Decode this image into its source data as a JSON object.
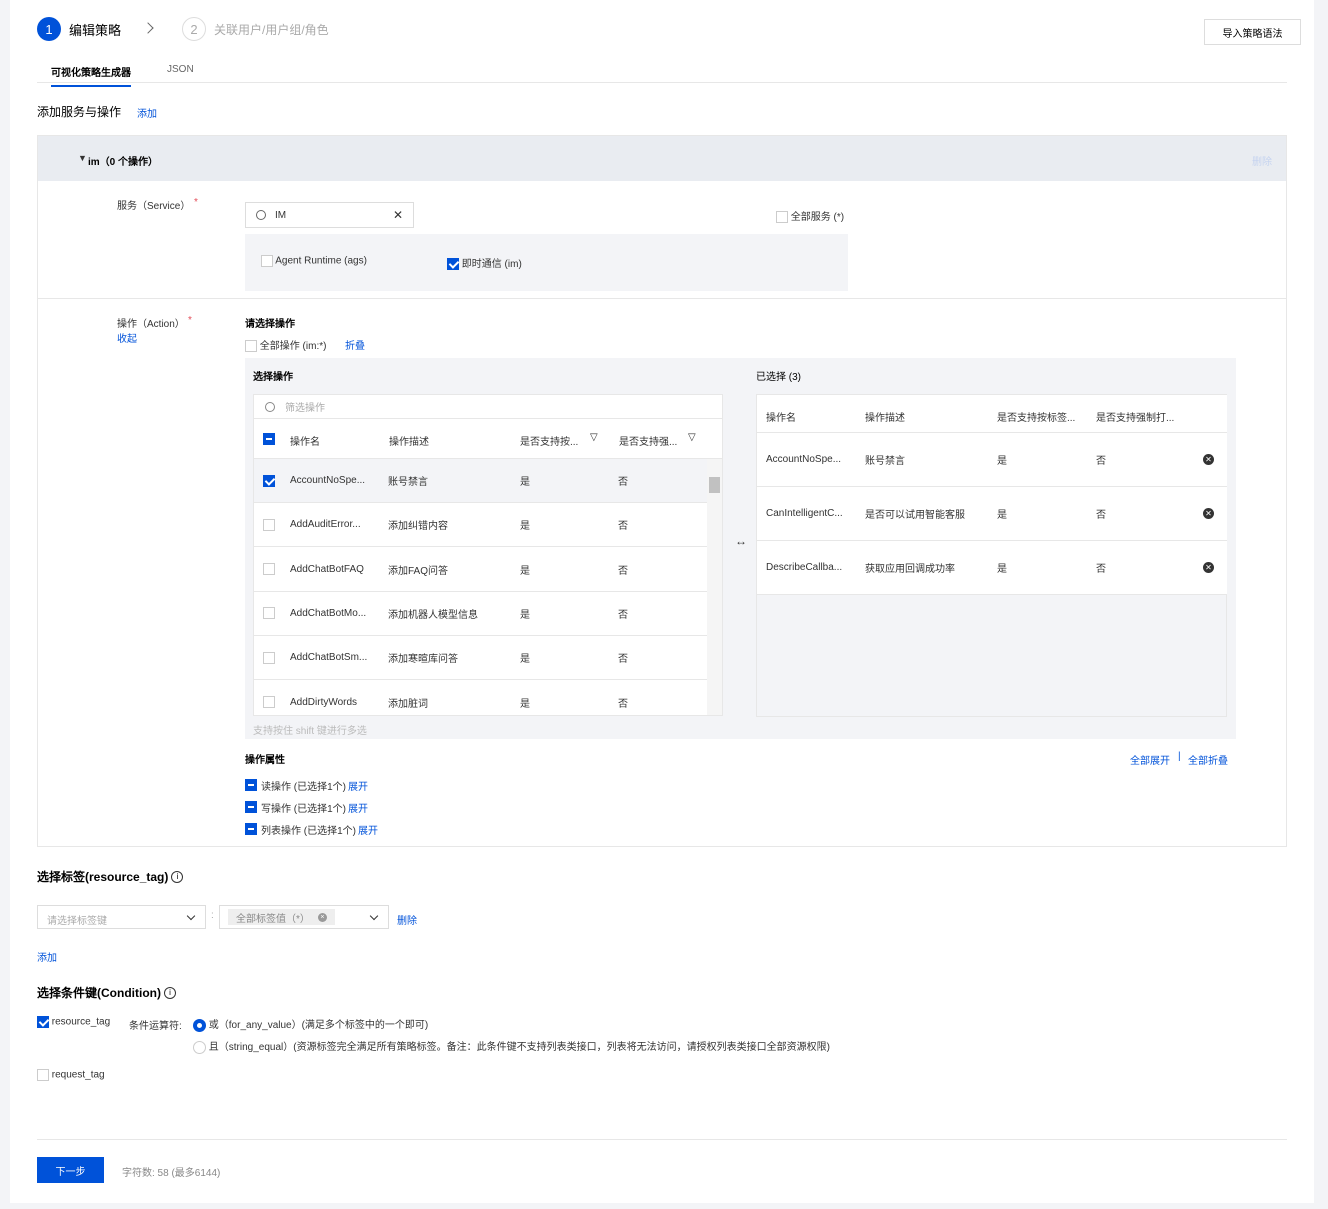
{
  "steps": [
    {
      "num": "1",
      "label": "编辑策略"
    },
    {
      "num": "2",
      "label": "关联用户/用户组/角色"
    }
  ],
  "import_button": "导入策略语法",
  "tabs": [
    {
      "label": "可视化策略生成器",
      "active": true
    },
    {
      "label": "JSON",
      "active": false
    }
  ],
  "section_title": "添加服务与操作",
  "section_add": "添加",
  "service_block": {
    "title": "im（0 个操作）",
    "delete": "删除",
    "service_label": "服务（Service）",
    "required": "*",
    "search_value": "IM",
    "all_services": "全部服务 (*)",
    "options": [
      {
        "label": "Agent Runtime (ags)",
        "checked": false
      },
      {
        "label": "即时通信 (im)",
        "checked": true
      }
    ],
    "action_label": "操作（Action）",
    "collapse": "收起",
    "choose_title": "请选择操作",
    "all_actions": "全部操作 (im:*)",
    "fold": "折叠",
    "left_title": "选择操作",
    "filter_placeholder": "筛选操作",
    "columns": [
      "操作名",
      "操作描述",
      "是否支持按...",
      "是否支持强..."
    ],
    "rows": [
      {
        "name": "AccountNoSpe...",
        "desc": "账号禁言",
        "tag": "是",
        "force": "否",
        "checked": true
      },
      {
        "name": "AddAuditError...",
        "desc": "添加纠错内容",
        "tag": "是",
        "force": "否",
        "checked": false
      },
      {
        "name": "AddChatBotFAQ",
        "desc": "添加FAQ问答",
        "tag": "是",
        "force": "否",
        "checked": false
      },
      {
        "name": "AddChatBotMo...",
        "desc": "添加机器人模型信息",
        "tag": "是",
        "force": "否",
        "checked": false
      },
      {
        "name": "AddChatBotSm...",
        "desc": "添加寒暄库问答",
        "tag": "是",
        "force": "否",
        "checked": false
      },
      {
        "name": "AddDirtyWords",
        "desc": "添加脏词",
        "tag": "是",
        "force": "否",
        "checked": false
      }
    ],
    "hint": "支持按住 shift 键进行多选",
    "right_title": "已选择 (3)",
    "right_columns": [
      "操作名",
      "操作描述",
      "是否支持按标签...",
      "是否支持强制打..."
    ],
    "selected": [
      {
        "name": "AccountNoSpe...",
        "desc": "账号禁言",
        "tag": "是",
        "force": "否"
      },
      {
        "name": "CanIntelligentC...",
        "desc": "是否可以试用智能客服",
        "tag": "是",
        "force": "否"
      },
      {
        "name": "DescribeCallba...",
        "desc": "获取应用回调成功率",
        "tag": "是",
        "force": "否"
      }
    ],
    "attr_title": "操作属性",
    "expand_all": "全部展开",
    "collapse_all": "全部折叠",
    "attrs": [
      {
        "label": "读操作 (已选择1个)",
        "link": "展开"
      },
      {
        "label": "写操作 (已选择1个)",
        "link": "展开"
      },
      {
        "label": "列表操作 (已选择1个)",
        "link": "展开"
      }
    ]
  },
  "tags": {
    "title": "选择标签(resource_tag)",
    "key_placeholder": "请选择标签键",
    "value_chip": "全部标签值（*）",
    "delete": "删除",
    "add": "添加"
  },
  "condition": {
    "title": "选择条件键(Condition)",
    "resource_tag": "resource_tag",
    "operator_label": "条件运算符:",
    "or_option": "或（for_any_value）(满足多个标签中的一个即可)",
    "and_option": "且（string_equal）(资源标签完全满足所有策略标签。备注：此条件键不支持列表类接口，列表将无法访问，请授权列表类接口全部资源权限)",
    "request_tag": "request_tag"
  },
  "footer": {
    "next": "下一步",
    "char_count": "字符数: 58 (最多6144)"
  },
  "colors": {
    "accent": "#0052d9"
  }
}
